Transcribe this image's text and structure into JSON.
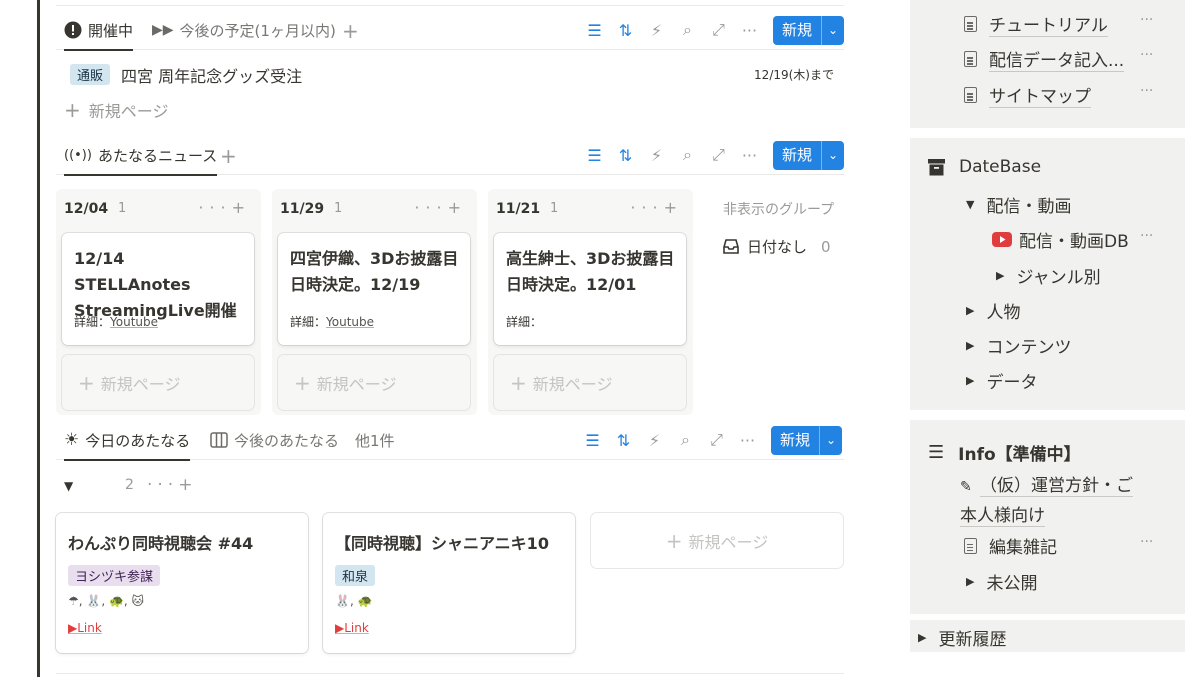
{
  "section1": {
    "tabs": [
      {
        "label": "開催中",
        "icon": "alert-circle-icon"
      },
      {
        "label": "今後の予定(1ヶ月以内)",
        "icon": "fast-forward-icon"
      }
    ],
    "new_label": "新規",
    "row": {
      "tag": "通販",
      "title": "四宮 周年記念グッズ受注",
      "date": "12/19(木)まで"
    },
    "new_page": "新規ページ"
  },
  "section2": {
    "tab": {
      "label": "あたなるニュース",
      "icon": "broadcast-icon"
    },
    "new_label": "新規",
    "columns": [
      {
        "date": "12/04",
        "count": "1",
        "title": "12/14 STELLAnotes StreamingLive開催",
        "detail_label": "詳細：",
        "detail_link": "Youtube"
      },
      {
        "date": "11/29",
        "count": "1",
        "title": "四宮伊織、3Dお披露目日時決定。12/19",
        "detail_label": "詳細：",
        "detail_link": "Youtube"
      },
      {
        "date": "11/21",
        "count": "1",
        "title": "高生紳士、3Dお披露目日時決定。12/01",
        "detail_label": "詳細：",
        "detail_link": ""
      }
    ],
    "new_page": "新規ページ",
    "hidden_groups": "非表示のグループ",
    "no_date": {
      "label": "日付なし",
      "count": "0"
    }
  },
  "section3": {
    "tabs": [
      {
        "label": "今日のあたなる",
        "icon": "sun-icon"
      },
      {
        "label": "今後のあたなる",
        "icon": "board-icon"
      },
      {
        "label": "他1件"
      }
    ],
    "new_label": "新規",
    "group_count": "2",
    "cards": [
      {
        "title": "わんぷり同時視聴会 #44",
        "tag": "ヨシヅキ参謀",
        "tag_color": "#e8deee",
        "emoji": "☂, 🐰, 🐢, 🐱",
        "link": "▶Link"
      },
      {
        "title": "【同時視聴】シャニアニキ10",
        "tag": "和泉",
        "tag_color": "#d3e5ef",
        "emoji": "🐰, 🐢",
        "link": "▶Link"
      }
    ],
    "new_page": "新規ページ"
  },
  "sidebar": {
    "pages": [
      {
        "label": "チュートリアル"
      },
      {
        "label": "配信データ記入..."
      },
      {
        "label": "サイトマップ"
      }
    ],
    "database": {
      "title": "DateBase",
      "items": {
        "haishin": "配信・動画",
        "haishin_db": "配信・動画DB",
        "genre": "ジャンル別",
        "person": "人物",
        "contents": "コンテンツ",
        "data": "データ"
      }
    },
    "info": {
      "title": "Info【準備中】",
      "policy_line1": "（仮）運営方針・ご",
      "policy_line2": "本人様向け",
      "editing": "編集雑記",
      "unpublished": "未公開"
    },
    "history": "更新履歴"
  },
  "colors": {
    "accent": "#2383e2",
    "sidebar_bg": "#f1f1ef",
    "tag_blue": "#d3e5ef",
    "link_red": "#e03e3e"
  }
}
